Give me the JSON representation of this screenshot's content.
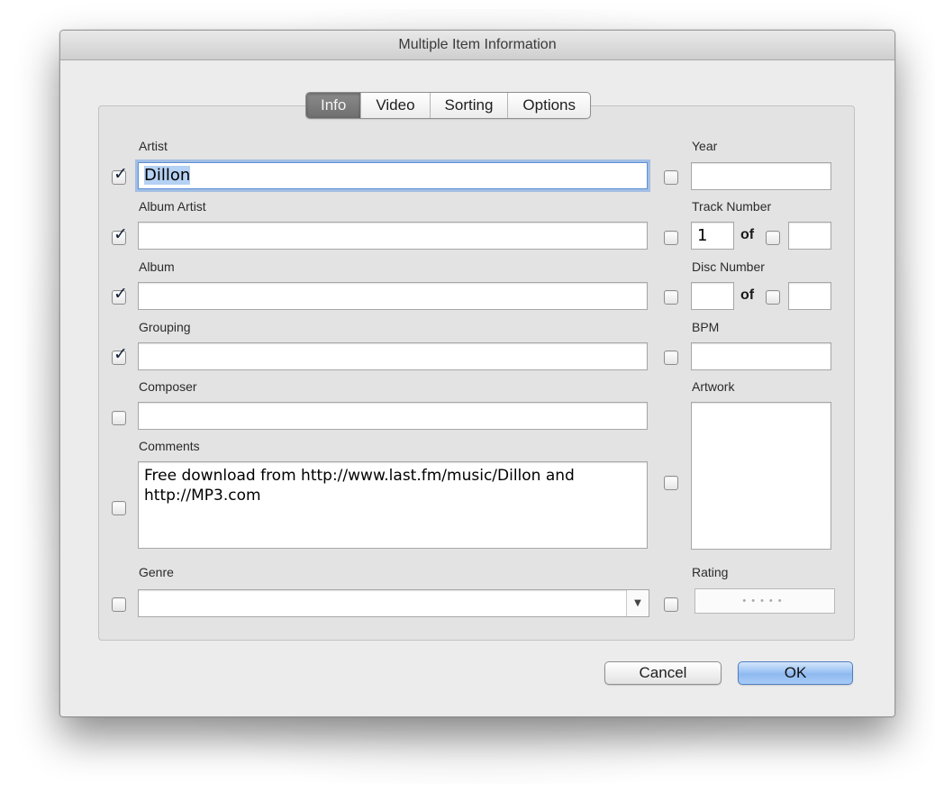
{
  "window": {
    "title": "Multiple Item Information"
  },
  "tabs": [
    {
      "label": "Info",
      "active": true
    },
    {
      "label": "Video",
      "active": false
    },
    {
      "label": "Sorting",
      "active": false
    },
    {
      "label": "Options",
      "active": false
    }
  ],
  "fields": {
    "artist": {
      "label": "Artist",
      "value": "Dillon",
      "checked": true
    },
    "album_artist": {
      "label": "Album Artist",
      "value": "",
      "checked": true
    },
    "album": {
      "label": "Album",
      "value": "",
      "checked": true
    },
    "grouping": {
      "label": "Grouping",
      "value": "",
      "checked": true
    },
    "composer": {
      "label": "Composer",
      "value": "",
      "checked": false
    },
    "comments": {
      "label": "Comments",
      "value": "Free download from http://www.last.fm/music/Dillon and http://MP3.com",
      "checked": false
    },
    "genre": {
      "label": "Genre",
      "value": "",
      "checked": false
    },
    "year": {
      "label": "Year",
      "value": "",
      "checked": false
    },
    "track_number": {
      "label": "Track Number",
      "value": "1",
      "of_label": "of",
      "total": "",
      "checked": false,
      "total_checked": false
    },
    "disc_number": {
      "label": "Disc Number",
      "value": "",
      "of_label": "of",
      "total": "",
      "checked": false,
      "total_checked": false
    },
    "bpm": {
      "label": "BPM",
      "value": "",
      "checked": false
    },
    "artwork": {
      "label": "Artwork",
      "checked": false
    },
    "rating": {
      "label": "Rating",
      "value": 0,
      "max": 5,
      "checked": false
    }
  },
  "buttons": {
    "cancel": "Cancel",
    "ok": "OK"
  },
  "icons": {
    "checkmark": "checkmark-icon",
    "dropdown": "chevron-down-icon",
    "rating_dot": "dot-icon"
  },
  "colors": {
    "focus_ring": "#6ea0e6",
    "default_button": "#8ebaf0",
    "active_tab": "#7a7a7a"
  }
}
